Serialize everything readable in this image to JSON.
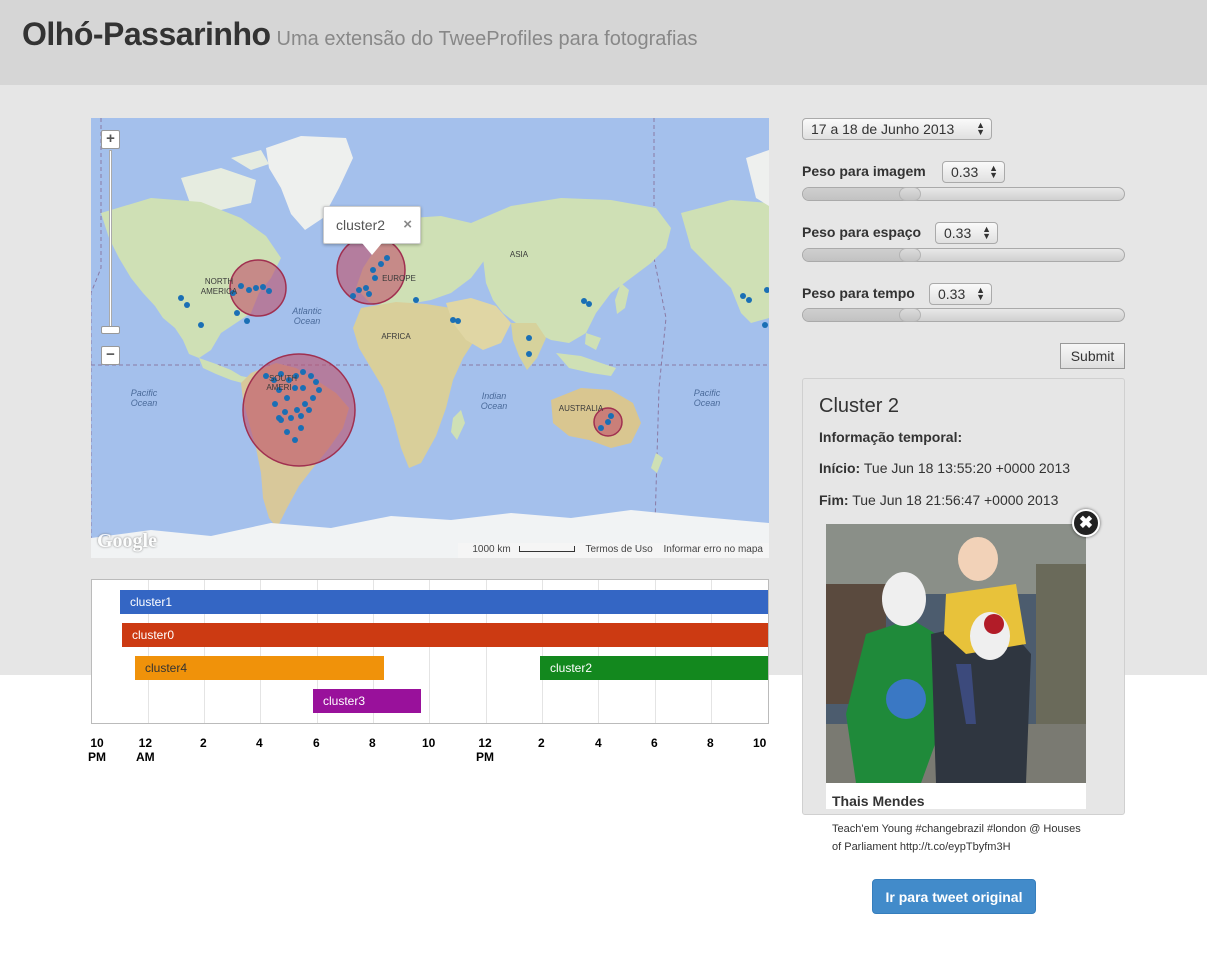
{
  "header": {
    "title": "Olhó-Passarinho",
    "subtitle": "Uma extensão do TweeProfiles para fotografias"
  },
  "map": {
    "labels": {
      "north_america": [
        "NORTH",
        "AMERICA"
      ],
      "atlantic": [
        "Atlantic",
        "Ocean"
      ],
      "europe": "EUROPE",
      "asia": "ASIA",
      "africa": "AFRICA",
      "pacific_left": [
        "Pacific",
        "Ocean"
      ],
      "pacific_right": [
        "Pacific",
        "Ocean"
      ],
      "south_america": [
        "SOUTH",
        "AMERI"
      ],
      "indian": [
        "Indian",
        "Ocean"
      ],
      "australia": "AUSTRALIA"
    },
    "popup": {
      "label": "cluster2",
      "close": "×"
    },
    "zoom_in": "+",
    "zoom_out": "−",
    "logo": "Google",
    "scale_label": "1000 km",
    "terms_link": "Termos de Uso",
    "report_link": "Informar erro no mapa",
    "colors": {
      "ocean": "#a4c0ec",
      "land": "#cfe0b5",
      "cluster": "#c0506a",
      "point": "#1a6fb5"
    }
  },
  "timeline": {
    "bars": [
      {
        "label": "cluster1",
        "color": "#3466c4"
      },
      {
        "label": "cluster0",
        "color": "#cc3a12"
      },
      {
        "label": "cluster4",
        "color": "#f0920a"
      },
      {
        "label": "cluster2",
        "color": "#13881e"
      },
      {
        "label": "cluster3",
        "color": "#99119b"
      }
    ],
    "ticks": [
      [
        "10",
        "PM"
      ],
      [
        "12",
        "AM"
      ],
      [
        "2",
        ""
      ],
      [
        "4",
        ""
      ],
      [
        "6",
        ""
      ],
      [
        "8",
        ""
      ],
      [
        "10",
        ""
      ],
      [
        "12",
        "PM"
      ],
      [
        "2",
        ""
      ],
      [
        "4",
        ""
      ],
      [
        "6",
        ""
      ],
      [
        "8",
        ""
      ],
      [
        "10",
        ""
      ]
    ]
  },
  "controls": {
    "date_range": "17 a 18 de Junho 2013",
    "weights": [
      {
        "label": "Peso para imagem",
        "value": "0.33",
        "level": 0.33
      },
      {
        "label": "Peso para espaço",
        "value": "0.33",
        "level": 0.33
      },
      {
        "label": "Peso para tempo",
        "value": "0.33",
        "level": 0.33
      }
    ],
    "submit_label": "Submit"
  },
  "cluster_info": {
    "title": "Cluster 2",
    "temporal_heading": "Informação temporal:",
    "start_label": "Início:",
    "start_value": "Tue Jun 18 13:55:20 +0000 2013",
    "end_label": "Fim:",
    "end_value": "Tue Jun 18 21:56:47 +0000 2013"
  },
  "tweet": {
    "close": "✖",
    "author": "Thais Mendes",
    "text": "Teach'em Young #changebrazil #london @ Houses of Parliament http://t.co/eypTbyfm3H",
    "button_label": "Ir para tweet original"
  }
}
